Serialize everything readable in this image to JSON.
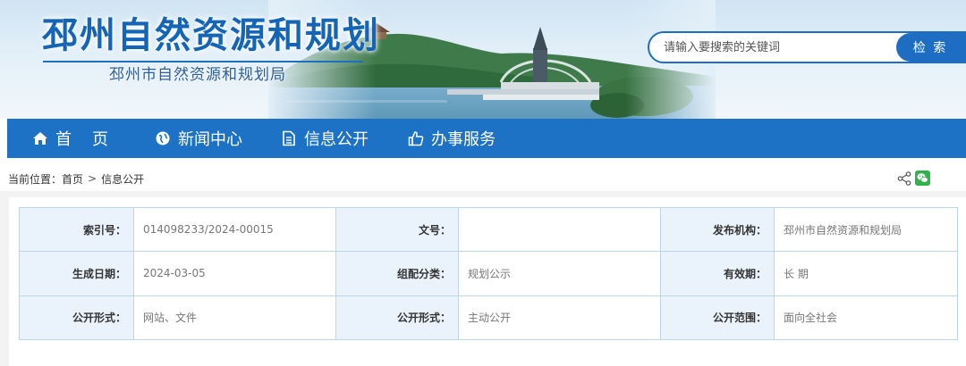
{
  "header": {
    "title": "邳州自然资源和规划",
    "subtitle": "邳州市自然资源和规划局"
  },
  "search": {
    "placeholder": "请输入要搜索的关键词",
    "button_label": "检 索"
  },
  "nav": {
    "items": [
      {
        "label": "首页",
        "icon": "home-icon"
      },
      {
        "label": "新闻中心",
        "icon": "globe-icon"
      },
      {
        "label": "信息公开",
        "icon": "document-icon"
      },
      {
        "label": "办事服务",
        "icon": "thumbs-up-icon"
      }
    ]
  },
  "breadcrumb": {
    "prefix": "当前位置：",
    "items": [
      "首页",
      "信息公开"
    ],
    "separator": ">"
  },
  "meta": {
    "rows": [
      [
        {
          "label": "索引号：",
          "value": "014098233/2024-00015"
        },
        {
          "label": "文号：",
          "value": ""
        },
        {
          "label": "发布机构：",
          "value": "邳州市自然资源和规划局"
        }
      ],
      [
        {
          "label": "生成日期：",
          "value": "2024-03-05"
        },
        {
          "label": "组配分类：",
          "value": "规划公示"
        },
        {
          "label": "有效期：",
          "value": "长 期"
        }
      ],
      [
        {
          "label": "公开形式：",
          "value": "网站、文件"
        },
        {
          "label": "公开形式：",
          "value": "主动公开"
        },
        {
          "label": "公开范围：",
          "value": "面向全社会"
        }
      ]
    ]
  },
  "colors": {
    "brand_blue": "#1d72c6",
    "title_blue": "#1565b7",
    "table_border": "#b9d6ec",
    "label_bg": "#eaf3fb",
    "wechat_green": "#2fb34a"
  }
}
